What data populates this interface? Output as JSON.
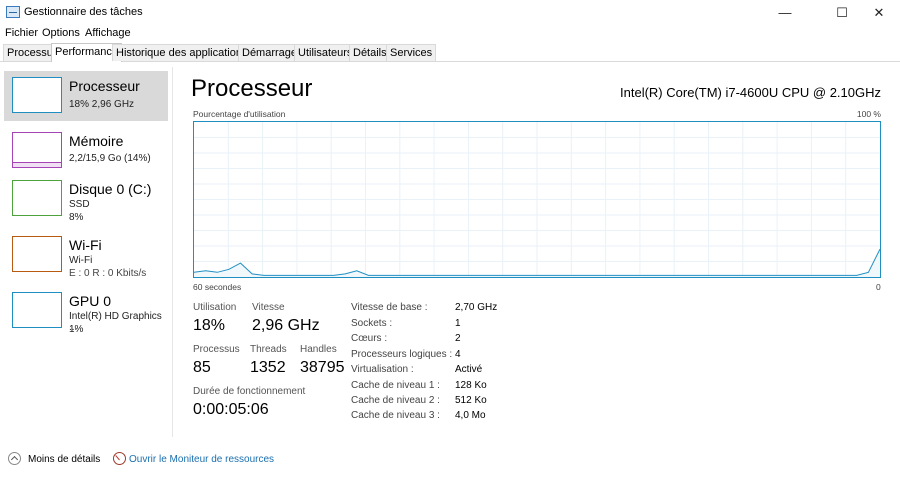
{
  "window": {
    "title": "Gestionnaire des tâches",
    "controls": {
      "minimize": "—",
      "maximize": "☐",
      "close": "✕"
    }
  },
  "menu": [
    "Fichier",
    "Options",
    "Affichage"
  ],
  "tabs": [
    "Processus",
    "Performance",
    "Historique des applications",
    "Démarrage",
    "Utilisateurs",
    "Détails",
    "Services"
  ],
  "active_tab": "Performance",
  "sidebar": {
    "items": [
      {
        "title": "Processeur",
        "sub1": "18% 2,96 GHz",
        "sub2": "",
        "color": "#1f8fc2",
        "selected": true
      },
      {
        "title": "Mémoire",
        "sub1": "2,2/15,9 Go (14%)",
        "sub2": "",
        "color": "#a545b5"
      },
      {
        "title": "Disque 0 (C:)",
        "sub1": "SSD",
        "sub2": "8%",
        "color": "#4ca33c"
      },
      {
        "title": "Wi-Fi",
        "sub1": "Wi-Fi",
        "sub2": "E : 0 R : 0 Kbits/s",
        "color": "#b85a12"
      },
      {
        "title": "GPU 0",
        "sub1": "Intel(R) HD Graphics ...",
        "sub2": "1%",
        "color": "#1f8fc2"
      }
    ]
  },
  "main": {
    "title": "Processeur",
    "cpu_name": "Intel(R) Core(TM) i7-4600U CPU @ 2.10GHz",
    "graph_label": "Pourcentage d'utilisation",
    "graph_max": "100 %",
    "graph_time": "60 secondes",
    "graph_zero": "0",
    "graph_color": "#1f8fc2",
    "usage_series": [
      3,
      4,
      3,
      5,
      9,
      2,
      1,
      1,
      1,
      1,
      1,
      1,
      1,
      2,
      4,
      1,
      1,
      1,
      1,
      1,
      1,
      1,
      1,
      1,
      1,
      1,
      1,
      1,
      1,
      1,
      1,
      1,
      1,
      1,
      1,
      1,
      1,
      1,
      1,
      1,
      1,
      1,
      1,
      1,
      1,
      1,
      1,
      1,
      1,
      1,
      1,
      1,
      1,
      1,
      1,
      1,
      1,
      1,
      3,
      18
    ],
    "stats": {
      "utilisation_label": "Utilisation",
      "utilisation": "18%",
      "vitesse_label": "Vitesse",
      "vitesse": "2,96 GHz",
      "processus_label": "Processus",
      "processus": "85",
      "threads_label": "Threads",
      "threads": "1352",
      "handles_label": "Handles",
      "handles": "38795",
      "uptime_label": "Durée de fonctionnement",
      "uptime": "0:00:05:06"
    },
    "details": [
      {
        "k": "Vitesse de base :",
        "v": "2,70 GHz"
      },
      {
        "k": "Sockets :",
        "v": "1"
      },
      {
        "k": "Cœurs :",
        "v": "2"
      },
      {
        "k": "Processeurs logiques :",
        "v": "4"
      },
      {
        "k": "Virtualisation :",
        "v": "Activé"
      },
      {
        "k": "Cache de niveau 1 :",
        "v": "128 Ko"
      },
      {
        "k": "Cache de niveau 2 :",
        "v": "512 Ko"
      },
      {
        "k": "Cache de niveau 3 :",
        "v": "4,0 Mo"
      }
    ]
  },
  "footer": {
    "less_details": "Moins de détails",
    "resource_monitor": "Ouvrir le Moniteur de ressources"
  }
}
